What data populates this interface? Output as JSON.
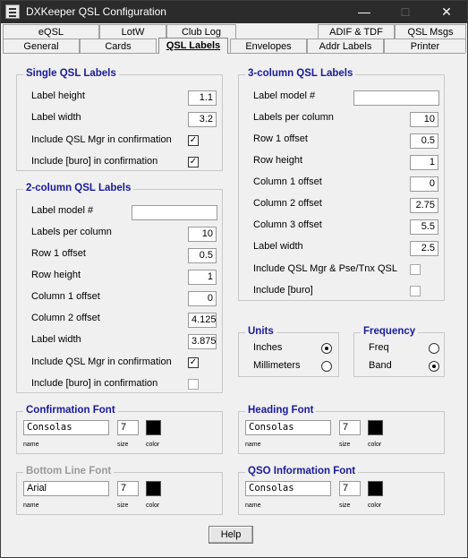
{
  "window": {
    "title": "DXKeeper QSL Configuration"
  },
  "tabs_row1": [
    "eQSL",
    "LotW",
    "Club Log",
    "ADIF & TDF",
    "QSL Msgs"
  ],
  "tabs_row2": [
    "General",
    "Cards",
    "QSL Labels",
    "Envelopes",
    "Addr Labels",
    "Printer"
  ],
  "active_tab": "QSL Labels",
  "single": {
    "legend": "Single QSL Labels",
    "height_label": "Label height",
    "height_value": "1.1",
    "width_label": "Label width",
    "width_value": "3.2",
    "mgr_label": "Include QSL Mgr in confirmation",
    "mgr_checked": true,
    "buro_label": "Include [buro] in confirmation",
    "buro_checked": true
  },
  "two_col": {
    "legend": "2-column QSL Labels",
    "model_label": "Label model #",
    "model_value": "",
    "lpc_label": "Labels per column",
    "lpc_value": "10",
    "row1_label": "Row 1 offset",
    "row1_value": "0.5",
    "rowh_label": "Row height",
    "rowh_value": "1",
    "col1_label": "Column 1 offset",
    "col1_value": "0",
    "col2_label": "Column 2 offset",
    "col2_value": "4.125",
    "lw_label": "Label width",
    "lw_value": "3.875",
    "mgr_label": "Include QSL Mgr in confirmation",
    "mgr_checked": true,
    "buro_label": "Include [buro] in confirmation",
    "buro_checked": false
  },
  "three_col": {
    "legend": "3-column QSL Labels",
    "model_label": "Label model #",
    "model_value": "",
    "lpc_label": "Labels per column",
    "lpc_value": "10",
    "row1_label": "Row 1 offset",
    "row1_value": "0.5",
    "rowh_label": "Row height",
    "rowh_value": "1",
    "col1_label": "Column 1 offset",
    "col1_value": "0",
    "col2_label": "Column 2 offset",
    "col2_value": "2.75",
    "col3_label": "Column 3 offset",
    "col3_value": "5.5",
    "lw_label": "Label width",
    "lw_value": "2.5",
    "mgr_label": "Include QSL Mgr & Pse/Tnx QSL",
    "mgr_checked": false,
    "buro_label": "Include [buro]",
    "buro_checked": false
  },
  "units": {
    "legend": "Units",
    "inches": "Inches",
    "millimeters": "Millimeters",
    "selected": "Inches"
  },
  "frequency": {
    "legend": "Frequency",
    "freq": "Freq",
    "band": "Band",
    "selected": "Band"
  },
  "fonts": {
    "name_caption": "name",
    "size_caption": "size",
    "color_caption": "color",
    "confirmation": {
      "legend": "Confirmation Font",
      "name": "Consolas",
      "size": "7",
      "color": "#000000"
    },
    "heading": {
      "legend": "Heading Font",
      "name": "Consolas",
      "size": "7",
      "color": "#000000"
    },
    "bottom_line": {
      "legend": "Bottom Line Font",
      "name": "Arial",
      "size": "7",
      "color": "#000000"
    },
    "qso_info": {
      "legend": "QSO Information Font",
      "name": "Consolas",
      "size": "7",
      "color": "#000000"
    }
  },
  "help_button": "Help"
}
